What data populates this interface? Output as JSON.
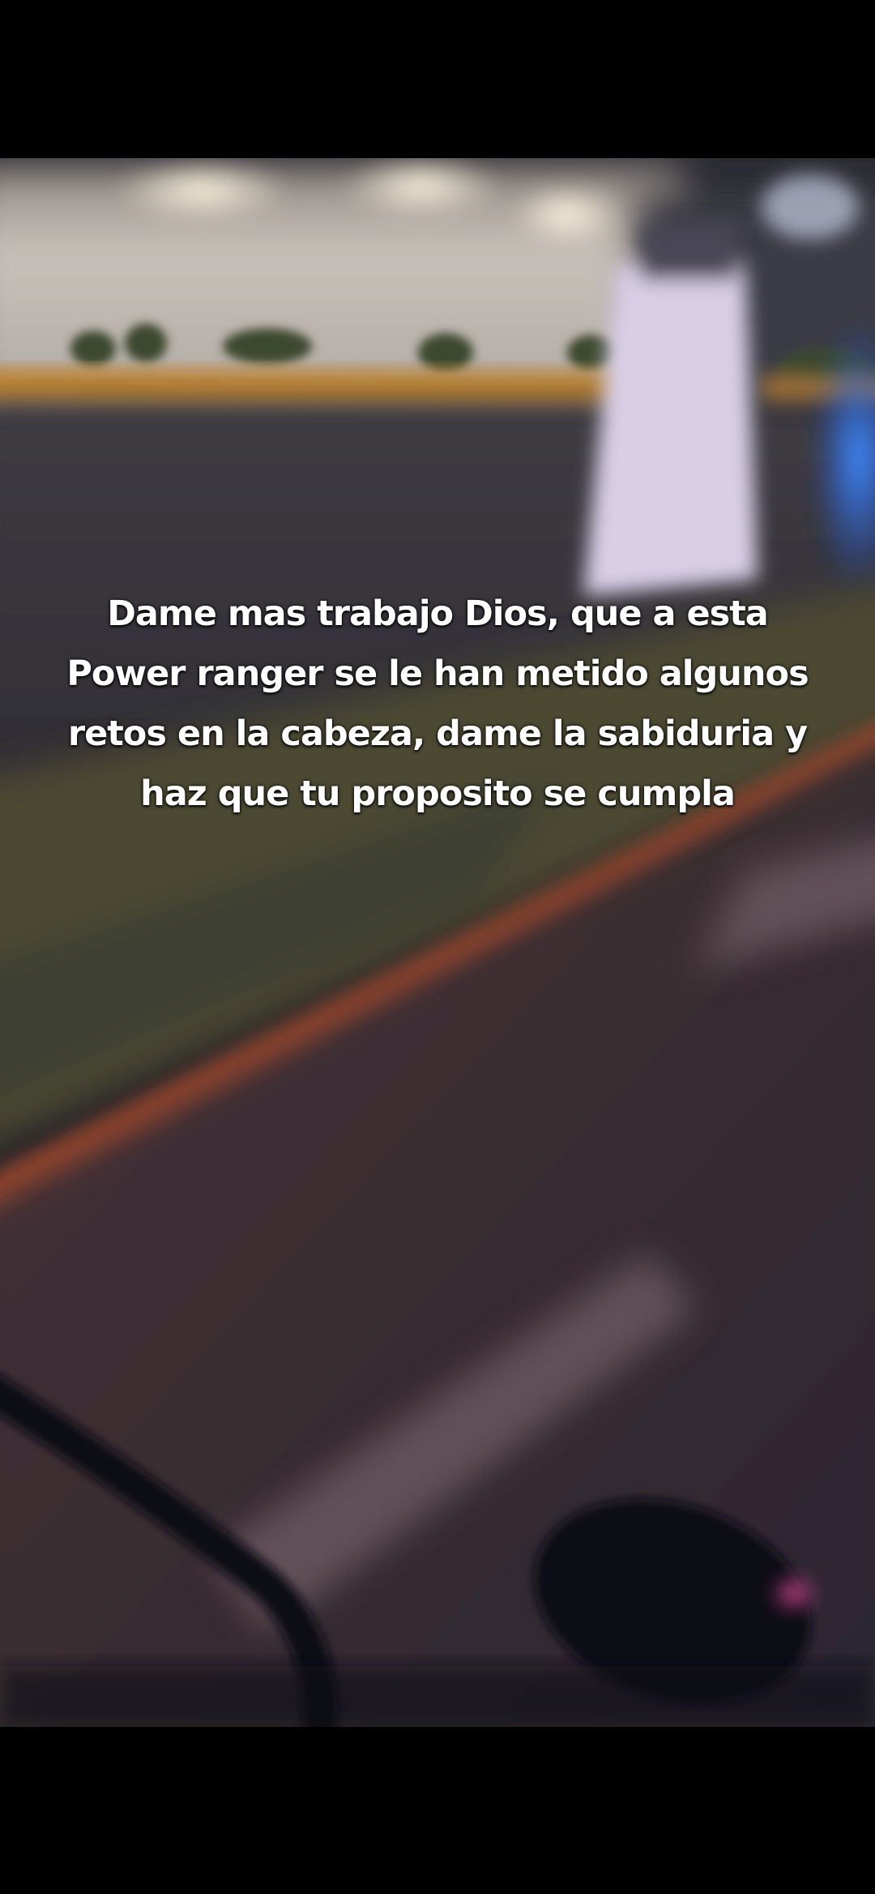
{
  "colors": {
    "background": "#000000",
    "caption_text": "#ffffff",
    "wall": "#cbc3bc",
    "curb_orange": "#c9892f",
    "road": "#3a363d",
    "grass": "#4b4a33",
    "lane_orange": "#c2512a",
    "pillar": "#d8cfe6",
    "blue_light": "#2f7dff",
    "mirror_pink": "#ff4fa8"
  },
  "caption": {
    "lines": [
      "Dame mas trabajo Dios, que a esta",
      "Power ranger se le han metido algunos",
      "retos en la cabeza, dame la sabiduria y",
      "haz que tu proposito se cumpla"
    ]
  }
}
